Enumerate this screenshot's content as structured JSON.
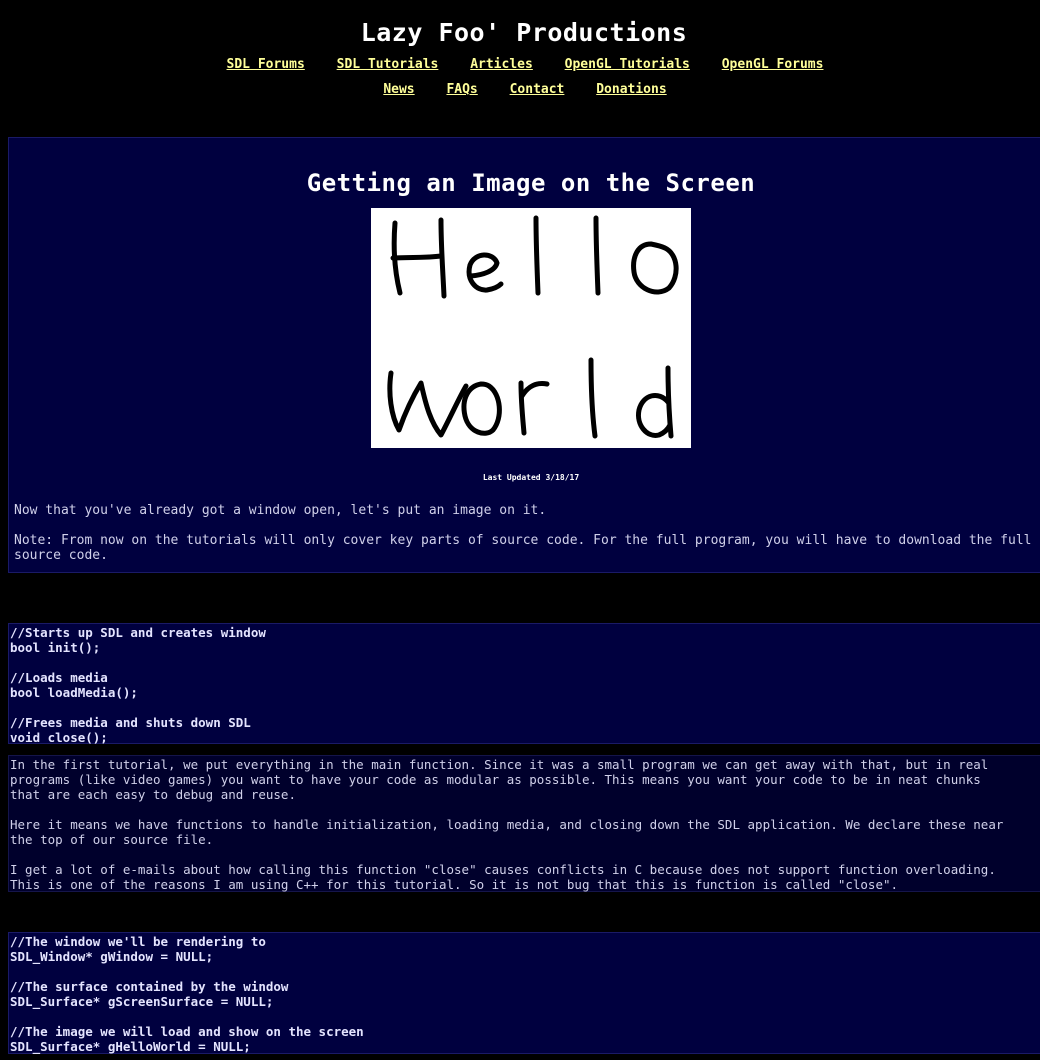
{
  "header": {
    "site_title": "Lazy Foo' Productions",
    "nav_row1": [
      "SDL Forums",
      "SDL Tutorials",
      "Articles",
      "OpenGL Tutorials",
      "OpenGL Forums"
    ],
    "nav_row2": [
      "News",
      "FAQs",
      "Contact",
      "Donations"
    ]
  },
  "intro": {
    "title": "Getting an Image on the Screen",
    "image_alt_text": "Hello World",
    "last_updated": "Last Updated 3/18/17",
    "para1": "Now that you've already got a window open, let's put an image on it.",
    "para2_line1": "Note: From now on the tutorials will only cover key parts of source code. For the full program, you will have to download the full",
    "para2_line2": "source code."
  },
  "code1": [
    "//Starts up SDL and creates window",
    "bool init();",
    "//Loads media",
    "bool loadMedia();",
    "//Frees media and shuts down SDL",
    "void close();"
  ],
  "explain1": [
    "In the first tutorial, we put everything in the main function. Since it was a small program we can get away with that, but in real",
    "programs (like video games) you want to have your code as modular as possible. This means you want your code to be in neat chunks",
    "that are each easy to debug and reuse.",
    "Here it means we have functions to handle initialization, loading media, and closing down the SDL application. We declare these near",
    "the top of our source file.",
    "I get a lot of e-mails about how calling this function \"close\" causes conflicts in C because does not support function overloading.",
    "This is one of the reasons I am using C++ for this tutorial. So it is not bug that this is function is called \"close\"."
  ],
  "code2": [
    "//The window we'll be rendering to",
    "SDL_Window* gWindow = NULL;",
    "//The surface contained by the window",
    "SDL_Surface* gScreenSurface = NULL;",
    "//The image we will load and show on the screen",
    "SDL_Surface* gHelloWorld = NULL;"
  ]
}
